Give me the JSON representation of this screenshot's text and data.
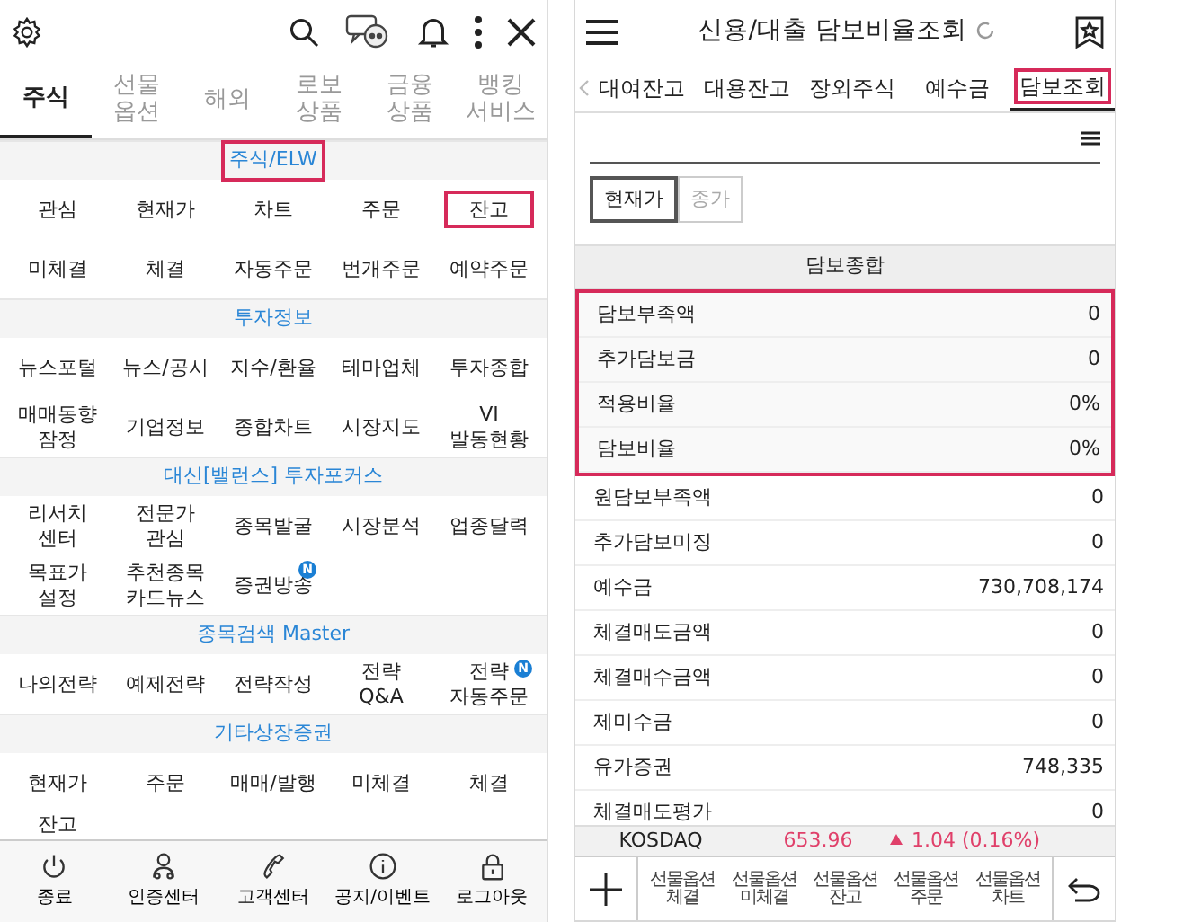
{
  "left_screen": {
    "tabs": [
      {
        "label": "주식",
        "selected": true
      },
      {
        "label": "선물\n옵션",
        "selected": false
      },
      {
        "label": "해외",
        "selected": false
      },
      {
        "label": "로보\n상품",
        "selected": false
      },
      {
        "label": "금융\n상품",
        "selected": false
      },
      {
        "label": "뱅킹\n서비스",
        "selected": false
      }
    ],
    "sections": [
      {
        "title": "주식/ELW",
        "highlighted": true,
        "items": [
          {
            "label": "관심",
            "highlighted": false
          },
          {
            "label": "현재가",
            "highlighted": false
          },
          {
            "label": "차트",
            "highlighted": false
          },
          {
            "label": "주문",
            "highlighted": false
          },
          {
            "label": "잔고",
            "highlighted": true
          },
          {
            "label": "미체결",
            "highlighted": false
          },
          {
            "label": "체결",
            "highlighted": false
          },
          {
            "label": "자동주문",
            "highlighted": false
          },
          {
            "label": "번개주문",
            "highlighted": false
          },
          {
            "label": "예약주문",
            "highlighted": false
          }
        ]
      },
      {
        "title": "투자정보",
        "highlighted": false,
        "items": [
          {
            "label": "뉴스포털",
            "highlighted": false
          },
          {
            "label": "뉴스/공시",
            "highlighted": false
          },
          {
            "label": "지수/환율",
            "highlighted": false
          },
          {
            "label": "테마업체",
            "highlighted": false
          },
          {
            "label": "투자종합",
            "highlighted": false
          },
          {
            "label": "매매동향\n잠정",
            "highlighted": false
          },
          {
            "label": "기업정보",
            "highlighted": false
          },
          {
            "label": "종합차트",
            "highlighted": false
          },
          {
            "label": "시장지도",
            "highlighted": false
          },
          {
            "label": "VI\n발동현황",
            "highlighted": false
          }
        ]
      },
      {
        "title": "대신[밸런스] 투자포커스",
        "highlighted": false,
        "items": [
          {
            "label": "리서치\n센터",
            "highlighted": false
          },
          {
            "label": "전문가\n관심",
            "highlighted": false
          },
          {
            "label": "종목발굴",
            "highlighted": false
          },
          {
            "label": "시장분석",
            "highlighted": false
          },
          {
            "label": "업종달력",
            "highlighted": false
          },
          {
            "label": "목표가\n설정",
            "highlighted": false
          },
          {
            "label": "추천종목\n카드뉴스",
            "highlighted": false
          },
          {
            "label": "증권방송",
            "highlighted": false,
            "badge": "N"
          }
        ]
      },
      {
        "title": "종목검색 Master",
        "highlighted": false,
        "items": [
          {
            "label": "나의전략",
            "highlighted": false
          },
          {
            "label": "예제전략",
            "highlighted": false
          },
          {
            "label": "전략작성",
            "highlighted": false
          },
          {
            "label": "전략 Q&A",
            "highlighted": false
          },
          {
            "label": "전략\n자동주문",
            "highlighted": false,
            "badge": "N"
          }
        ]
      },
      {
        "title": "기타상장증권",
        "highlighted": false,
        "items": [
          {
            "label": "현재가",
            "highlighted": false
          },
          {
            "label": "주문",
            "highlighted": false
          },
          {
            "label": "매매/발행",
            "highlighted": false
          },
          {
            "label": "미체결",
            "highlighted": false
          },
          {
            "label": "체결",
            "highlighted": false
          },
          {
            "label": "잔고",
            "highlighted": false
          }
        ]
      }
    ],
    "bottom_nav": [
      {
        "label": "종료",
        "kind": "power"
      },
      {
        "label": "인증센터",
        "kind": "people"
      },
      {
        "label": "고객센터",
        "kind": "phone"
      },
      {
        "label": "공지/이벤트",
        "kind": "info"
      },
      {
        "label": "로그아웃",
        "kind": "lock"
      }
    ]
  },
  "right_screen": {
    "title": "신용/대출 담보비율조회",
    "tabs": [
      {
        "label": "대여잔고",
        "selected": false,
        "highlighted": false
      },
      {
        "label": "대용잔고",
        "selected": false,
        "highlighted": false
      },
      {
        "label": "장외주식",
        "selected": false,
        "highlighted": false
      },
      {
        "label": "예수금",
        "selected": false,
        "highlighted": false
      },
      {
        "label": "담보조회",
        "selected": true,
        "highlighted": true
      }
    ],
    "price_toggle": [
      {
        "label": "현재가",
        "selected": true
      },
      {
        "label": "종가",
        "selected": false
      }
    ],
    "section_title": "담보종합",
    "rows": [
      {
        "label": "담보부족액",
        "value": "0",
        "highlighted": true
      },
      {
        "label": "추가담보금",
        "value": "0",
        "highlighted": true
      },
      {
        "label": "적용비율",
        "value": "0%",
        "highlighted": true
      },
      {
        "label": "담보비율",
        "value": "0%",
        "highlighted": true
      },
      {
        "label": "원담보부족액",
        "value": "0",
        "highlighted": false
      },
      {
        "label": "추가담보미징",
        "value": "0",
        "highlighted": false
      },
      {
        "label": "예수금",
        "value": "730,708,174",
        "highlighted": false
      },
      {
        "label": "체결매도금액",
        "value": "0",
        "highlighted": false
      },
      {
        "label": "체결매수금액",
        "value": "0",
        "highlighted": false
      },
      {
        "label": "제미수금",
        "value": "0",
        "highlighted": false
      },
      {
        "label": "유가증권",
        "value": "748,335",
        "highlighted": false
      },
      {
        "label": "체결매도평가",
        "value": "0",
        "highlighted": false
      }
    ],
    "ticker": {
      "name": "KOSDAQ",
      "value": "653.96",
      "change": "1.04 (0.16%)"
    },
    "shortcuts": [
      "선물옵션\n체결",
      "선물옵션\n미체결",
      "선물옵션\n잔고",
      "선물옵션\n주문",
      "선물옵션\n차트"
    ]
  }
}
